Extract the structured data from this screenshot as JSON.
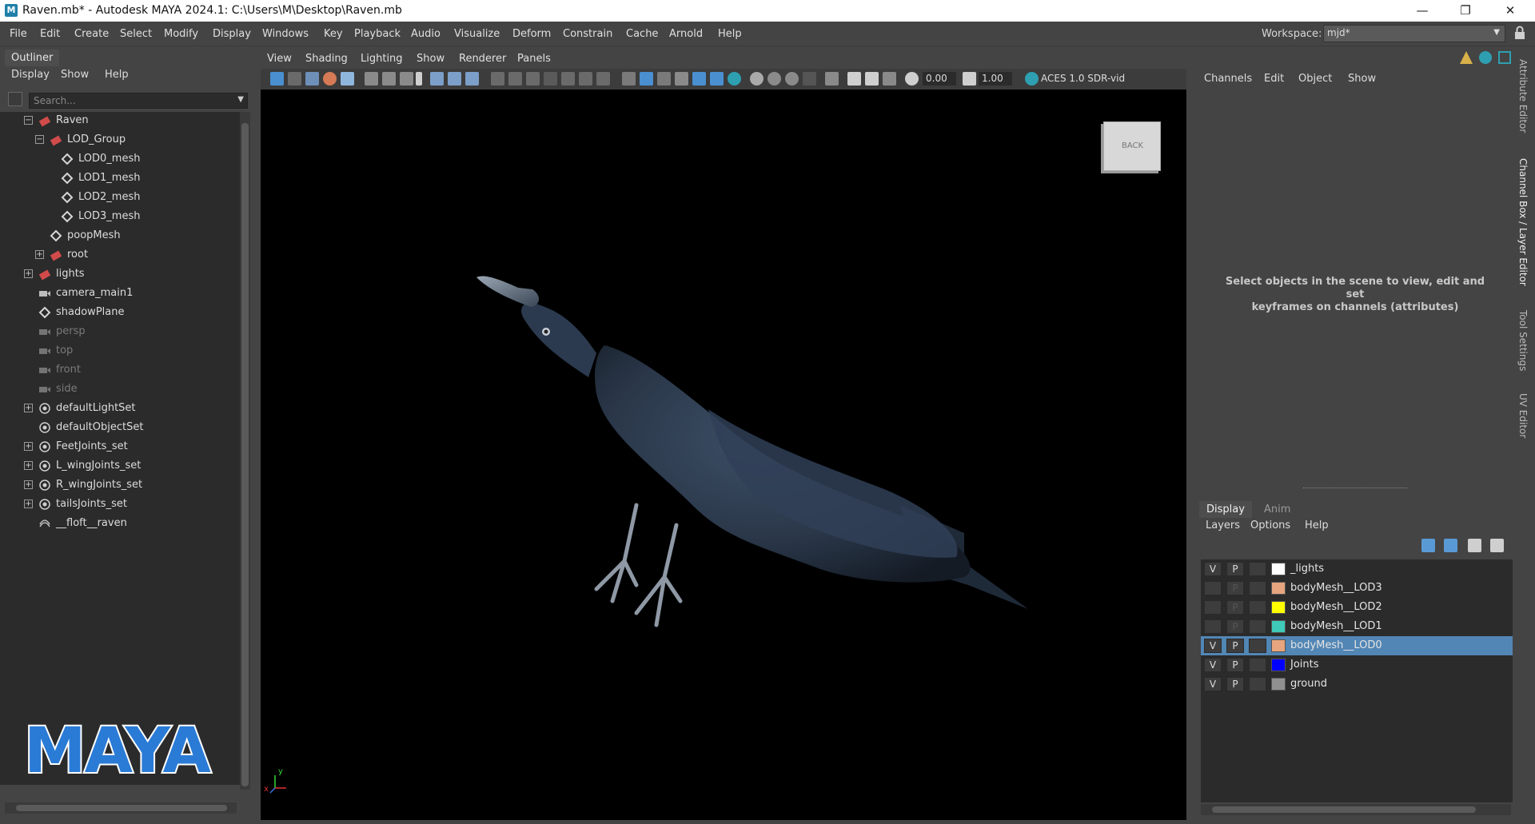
{
  "window": {
    "title": "Raven.mb* - Autodesk MAYA 2024.1: C:\\Users\\M\\Desktop\\Raven.mb",
    "minimize": "—",
    "restore": "❐",
    "close": "✕",
    "app_icon": "M"
  },
  "menubar": {
    "items": [
      "File",
      "Edit",
      "Create",
      "Select",
      "Modify",
      "Display",
      "Windows",
      "Key",
      "Playback",
      "Audio",
      "Visualize",
      "Deform",
      "Constrain",
      "Cache",
      "Arnold",
      "Help"
    ],
    "workspace_label": "Workspace:",
    "workspace_value": "mjd*"
  },
  "outliner": {
    "tab": "Outliner",
    "menu": [
      "Display",
      "Show",
      "Help"
    ],
    "search_placeholder": "Search...",
    "rows": [
      {
        "label": "Raven",
        "icon": "transform-group-icon",
        "expander": "⊟",
        "dim": false
      },
      {
        "label": "LOD_Group",
        "icon": "transform-group-icon",
        "expander": "⊟",
        "dim": false
      },
      {
        "label": "LOD0_mesh",
        "icon": "mesh-icon",
        "expander": "",
        "dim": false
      },
      {
        "label": "LOD1_mesh",
        "icon": "mesh-icon",
        "expander": "",
        "dim": false
      },
      {
        "label": "LOD2_mesh",
        "icon": "mesh-icon",
        "expander": "",
        "dim": false
      },
      {
        "label": "LOD3_mesh",
        "icon": "mesh-icon",
        "expander": "",
        "dim": false
      },
      {
        "label": "poopMesh",
        "icon": "mesh-icon",
        "expander": "",
        "dim": false
      },
      {
        "label": "root",
        "icon": "transform-group-icon",
        "expander": "⊞",
        "dim": false
      },
      {
        "label": "lights",
        "icon": "transform-group-icon",
        "expander": "⊞",
        "dim": false
      },
      {
        "label": "camera_main1",
        "icon": "camera-icon",
        "expander": "",
        "dim": false
      },
      {
        "label": "shadowPlane",
        "icon": "mesh-icon",
        "expander": "",
        "dim": false
      },
      {
        "label": "persp",
        "icon": "camera-icon",
        "expander": "",
        "dim": true
      },
      {
        "label": "top",
        "icon": "camera-icon",
        "expander": "",
        "dim": true
      },
      {
        "label": "front",
        "icon": "camera-icon",
        "expander": "",
        "dim": true
      },
      {
        "label": "side",
        "icon": "camera-icon",
        "expander": "",
        "dim": true
      },
      {
        "label": "defaultLightSet",
        "icon": "set-icon",
        "expander": "⊞",
        "dim": false
      },
      {
        "label": "defaultObjectSet",
        "icon": "set-icon",
        "expander": "",
        "dim": false
      },
      {
        "label": "FeetJoints_set",
        "icon": "set-icon",
        "expander": "⊞",
        "dim": false
      },
      {
        "label": "L_wingJoints_set",
        "icon": "set-icon",
        "expander": "⊞",
        "dim": false
      },
      {
        "label": "R_wingJoints_set",
        "icon": "set-icon",
        "expander": "⊞",
        "dim": false
      },
      {
        "label": "tailsJoints_set",
        "icon": "set-icon",
        "expander": "⊞",
        "dim": false
      },
      {
        "label": "__floft__raven",
        "icon": "loft-icon",
        "expander": "",
        "dim": false
      }
    ],
    "logo_text": "MAYA"
  },
  "viewport": {
    "menu": [
      "View",
      "Shading",
      "Lighting",
      "Show",
      "Renderer",
      "Panels"
    ],
    "field_a": "0.00",
    "field_b": "1.00",
    "color_space": "ACES 1.0 SDR-vid",
    "viewcube_label": "BACK",
    "axis_y": "y",
    "axis_x": "x"
  },
  "channelbox": {
    "menu": [
      "Channels",
      "Edit",
      "Object",
      "Show"
    ],
    "hint_line1": "Select objects in the scene to view, edit and set",
    "hint_line2": "keyframes on channels (attributes)"
  },
  "layers": {
    "tabs": [
      "Display",
      "Anim"
    ],
    "active_tab": "Display",
    "menu": [
      "Layers",
      "Options",
      "Help"
    ],
    "rows": [
      {
        "name": "_lights",
        "v": "V",
        "p": "P",
        "color": "#ffffff",
        "visible": true,
        "selected": false
      },
      {
        "name": "bodyMesh__LOD3",
        "v": "",
        "p": "P",
        "color": "#e6a57e",
        "visible": false,
        "selected": false
      },
      {
        "name": "bodyMesh__LOD2",
        "v": "",
        "p": "P",
        "color": "#ffff00",
        "visible": false,
        "selected": false
      },
      {
        "name": "bodyMesh__LOD1",
        "v": "",
        "p": "P",
        "color": "#3ec9b8",
        "visible": false,
        "selected": false
      },
      {
        "name": "bodyMesh__LOD0",
        "v": "V",
        "p": "P",
        "color": "#e6a57e",
        "visible": true,
        "selected": true
      },
      {
        "name": "Joints",
        "v": "V",
        "p": "P",
        "color": "#0000ff",
        "visible": true,
        "selected": false
      },
      {
        "name": "ground",
        "v": "V",
        "p": "P",
        "color": "#909090",
        "visible": true,
        "selected": false
      }
    ]
  },
  "side_tabs": [
    "Attribute Editor",
    "Channel Box / Layer Editor",
    "Tool Settings",
    "UV Editor"
  ]
}
